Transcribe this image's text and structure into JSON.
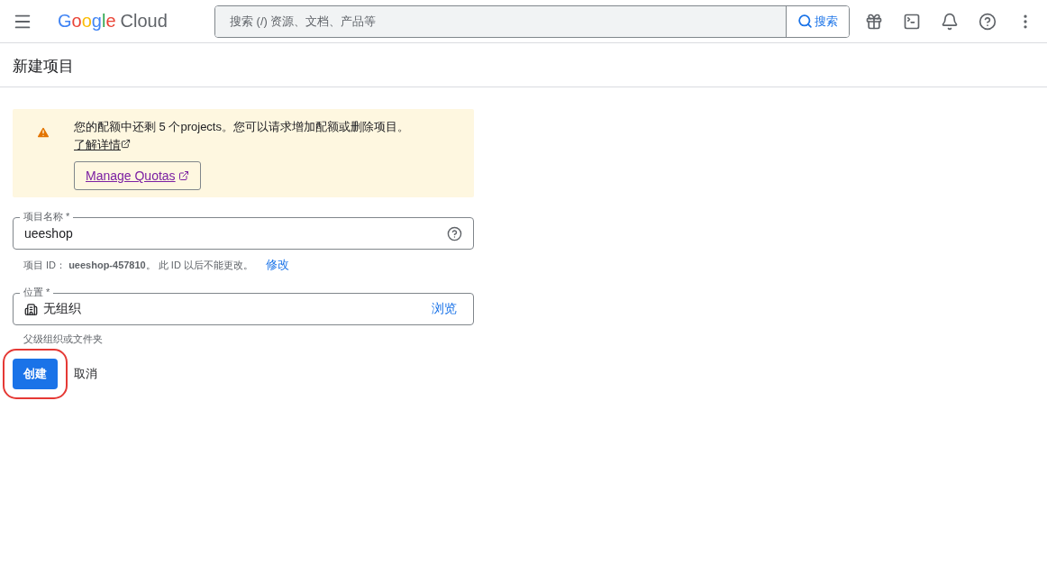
{
  "header": {
    "logo": {
      "brand": "Google",
      "product": "Cloud"
    },
    "search": {
      "placeholder": "搜索 (/) 资源、文档、产品等",
      "button": "搜索"
    }
  },
  "page_title": "新建项目",
  "notice": {
    "text": "您的配额中还剩 5 个projects。您可以请求增加配额或删除项目。",
    "link": "了解详情",
    "button": "Manage Quotas"
  },
  "fields": [
    {
      "kind": "text",
      "label": "项目名称 *",
      "value": "ueeshop",
      "hint": "项目 ID： **ueeshop-457810**。 此 ID 以后不能更改。",
      "hint_link": "修改"
    },
    {
      "kind": "picker",
      "label": "位置 *",
      "value": "无组织",
      "action": "浏览",
      "hint": "父级组织或文件夹"
    }
  ],
  "actions": [
    {
      "kind": "primary",
      "label": "创建",
      "highlighted": true
    },
    {
      "kind": "text",
      "label": "取消",
      "highlighted": false
    }
  ]
}
